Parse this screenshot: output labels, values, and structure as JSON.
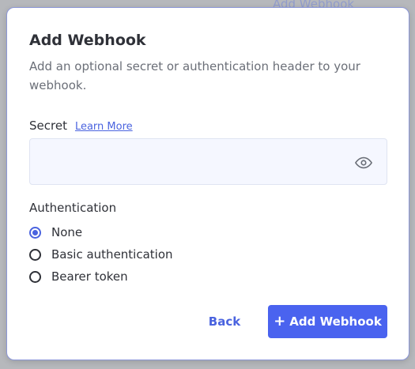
{
  "background": {
    "link_text": "Add Webhook"
  },
  "dialog": {
    "title": "Add Webhook",
    "description": "Add an optional secret or authentication header to your webhook.",
    "secret": {
      "label": "Secret",
      "learn_more": "Learn More",
      "value": "",
      "visibility_icon": "eye-icon"
    },
    "authentication": {
      "label": "Authentication",
      "options": [
        {
          "label": "None",
          "selected": true
        },
        {
          "label": "Basic authentication",
          "selected": false
        },
        {
          "label": "Bearer token",
          "selected": false
        }
      ]
    },
    "buttons": {
      "back": "Back",
      "add": "Add Webhook",
      "add_icon": "plus-icon"
    }
  },
  "colors": {
    "accent": "#4a63df",
    "primary_button": "#4a63ef",
    "input_bg": "#f5f7ff",
    "overlay": "#b6b8bc"
  }
}
